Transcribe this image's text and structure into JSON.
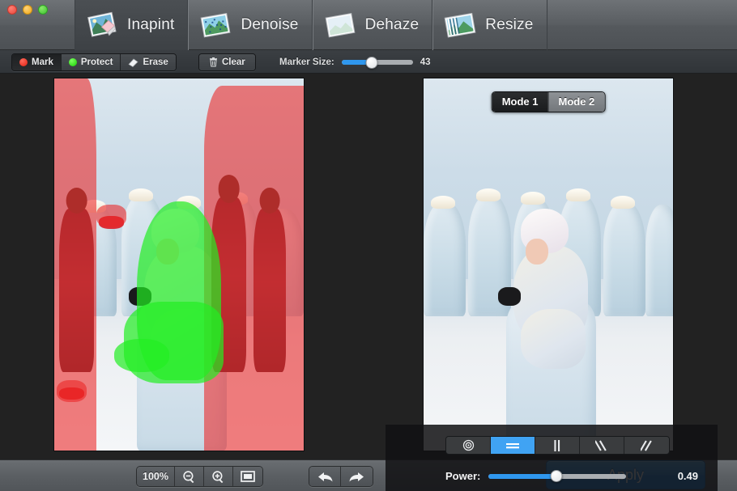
{
  "window": {
    "traffic_lights": [
      "close",
      "minimize",
      "zoom"
    ]
  },
  "tabs": [
    {
      "label": "Inapint",
      "icon": "photo-eraser-icon",
      "active": true
    },
    {
      "label": "Denoise",
      "icon": "photo-noise-icon",
      "active": false
    },
    {
      "label": "Dehaze",
      "icon": "photo-haze-icon",
      "active": false
    },
    {
      "label": "Resize",
      "icon": "photo-resize-icon",
      "active": false
    }
  ],
  "options_bar": {
    "tools": [
      {
        "label": "Mark",
        "icon": "red-dot-icon",
        "selected": true
      },
      {
        "label": "Protect",
        "icon": "green-dot-icon",
        "selected": false
      },
      {
        "label": "Erase",
        "icon": "eraser-icon",
        "selected": false
      }
    ],
    "clear": {
      "label": "Clear",
      "icon": "trash-icon"
    },
    "marker_size": {
      "label": "Marker Size:",
      "value": "43",
      "percent": 42
    }
  },
  "canvas": {
    "left_pane_name": "source-image-with-marks",
    "right_pane_name": "result-image-preview",
    "mode_switch": [
      {
        "label": "Mode 1",
        "active": true
      },
      {
        "label": "Mode 2",
        "active": false
      }
    ]
  },
  "fx_panel": {
    "direction_buttons": [
      {
        "name": "auto-direction-icon",
        "glyph": "target",
        "active": false
      },
      {
        "name": "horizontal-direction-icon",
        "glyph": "horizontal",
        "active": true
      },
      {
        "name": "vertical-direction-icon",
        "glyph": "vertical",
        "active": false
      },
      {
        "name": "diagonal-back-icon",
        "glyph": "backslash",
        "active": false
      },
      {
        "name": "diagonal-forward-icon",
        "glyph": "slash",
        "active": false
      }
    ],
    "power": {
      "label": "Power:",
      "value": "0.49",
      "percent": 49
    }
  },
  "bottom_bar": {
    "zoom_level": "100%",
    "zoom_out_icon": "zoom-out-icon",
    "zoom_in_icon": "zoom-in-icon",
    "fit_icon": "fit-to-screen-icon",
    "undo_icon": "undo-arrow-icon",
    "redo_icon": "redo-arrow-icon",
    "apply_label": "Apply"
  },
  "colors": {
    "accent": "#2f95ea",
    "mark": "#ec2424",
    "protect": "#22ee22",
    "chrome": "#5a5e62",
    "canvas_bg": "#222222"
  }
}
